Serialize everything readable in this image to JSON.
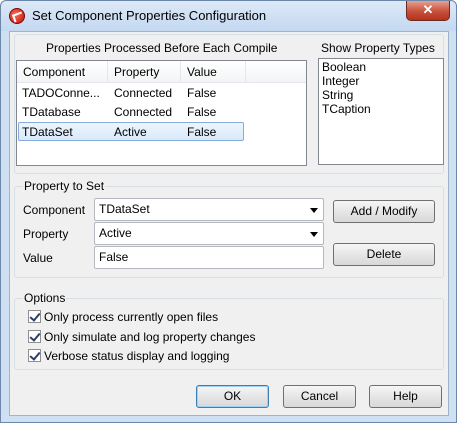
{
  "window": {
    "title": "Set Component Properties Configuration",
    "close_label": "✕"
  },
  "processed": {
    "label": "Properties Processed Before Each Compile",
    "columns": [
      "Component",
      "Property",
      "Value"
    ],
    "rows": [
      {
        "component": "TADOConne...",
        "property": "Connected",
        "value": "False"
      },
      {
        "component": "TDatabase",
        "property": "Connected",
        "value": "False"
      },
      {
        "component": "TDataSet",
        "property": "Active",
        "value": "False"
      }
    ]
  },
  "show_types": {
    "label": "Show Property Types",
    "items": [
      "Boolean",
      "Integer",
      "String",
      "TCaption"
    ]
  },
  "property_to_set": {
    "label": "Property to Set",
    "component_label": "Component",
    "component_value": "TDataSet",
    "property_label": "Property",
    "property_value": "Active",
    "value_label": "Value",
    "value_value": "False",
    "add_modify_label": "Add / Modify",
    "delete_label": "Delete"
  },
  "options": {
    "label": "Options",
    "items": [
      {
        "label": "Only process currently open files",
        "checked": true
      },
      {
        "label": "Only simulate and log property changes",
        "checked": true
      },
      {
        "label": "Verbose status display and logging",
        "checked": true
      }
    ]
  },
  "buttons": {
    "ok": "OK",
    "cancel": "Cancel",
    "help": "Help"
  }
}
